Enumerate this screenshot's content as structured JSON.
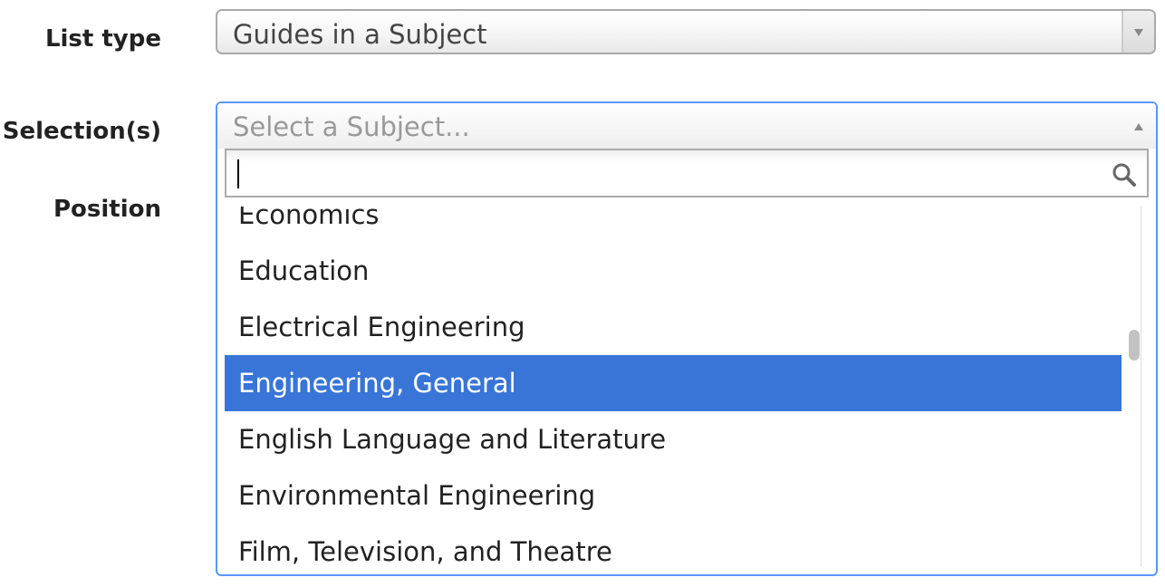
{
  "form": {
    "list_type_label": "List type",
    "selections_label": "Selection(s)",
    "position_label": "Position"
  },
  "list_type_select": {
    "value": "Guides in a Subject",
    "icon": "chevron-down-icon"
  },
  "subject_select": {
    "placeholder": "Select a Subject...",
    "search_value": "",
    "search_icon": "search-icon",
    "options": [
      "Economics",
      "Education",
      "Electrical Engineering",
      "Engineering, General",
      "English Language and Literature",
      "Environmental Engineering",
      "Film, Television, and Theatre"
    ],
    "highlighted": "Engineering, General",
    "highlight_color": "#3875d7",
    "focus_border_color": "#5897fb"
  }
}
